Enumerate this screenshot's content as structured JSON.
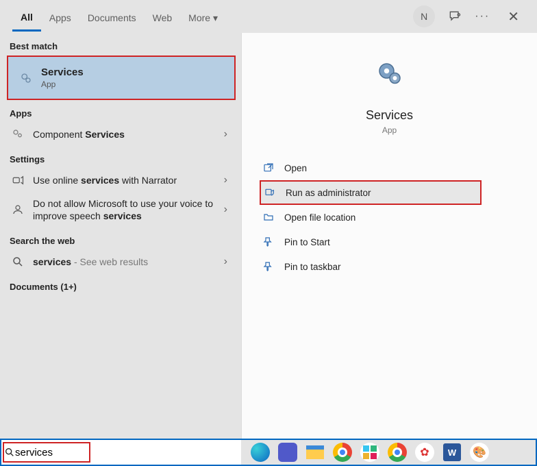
{
  "tabs": {
    "items": [
      {
        "label": "All",
        "active": true
      },
      {
        "label": "Apps"
      },
      {
        "label": "Documents"
      },
      {
        "label": "Web"
      },
      {
        "label": "More ▾"
      }
    ]
  },
  "avatar_letter": "N",
  "left": {
    "best_match_label": "Best match",
    "best": {
      "title": "Services",
      "sub": "App"
    },
    "apps_label": "Apps",
    "apps": [
      {
        "prefix": "Component ",
        "bold": "Services"
      }
    ],
    "settings_label": "Settings",
    "settings": [
      {
        "prefix": "Use online ",
        "bold": "services",
        "suffix": " with Narrator"
      },
      {
        "prefix": "Do not allow Microsoft to use your voice to improve speech ",
        "bold": "services",
        "suffix": ""
      }
    ],
    "web_label": "Search the web",
    "web": [
      {
        "bold": "services",
        "faint": " - See web results"
      }
    ],
    "documents_label": "Documents (1+)"
  },
  "preview": {
    "title": "Services",
    "sub": "App",
    "actions": [
      {
        "icon": "open",
        "label": "Open"
      },
      {
        "icon": "admin",
        "label": "Run as administrator",
        "highlight": true
      },
      {
        "icon": "fileloc",
        "label": "Open file location"
      },
      {
        "icon": "pinstart",
        "label": "Pin to Start"
      },
      {
        "icon": "pintask",
        "label": "Pin to taskbar"
      }
    ]
  },
  "search": {
    "value": "services"
  }
}
